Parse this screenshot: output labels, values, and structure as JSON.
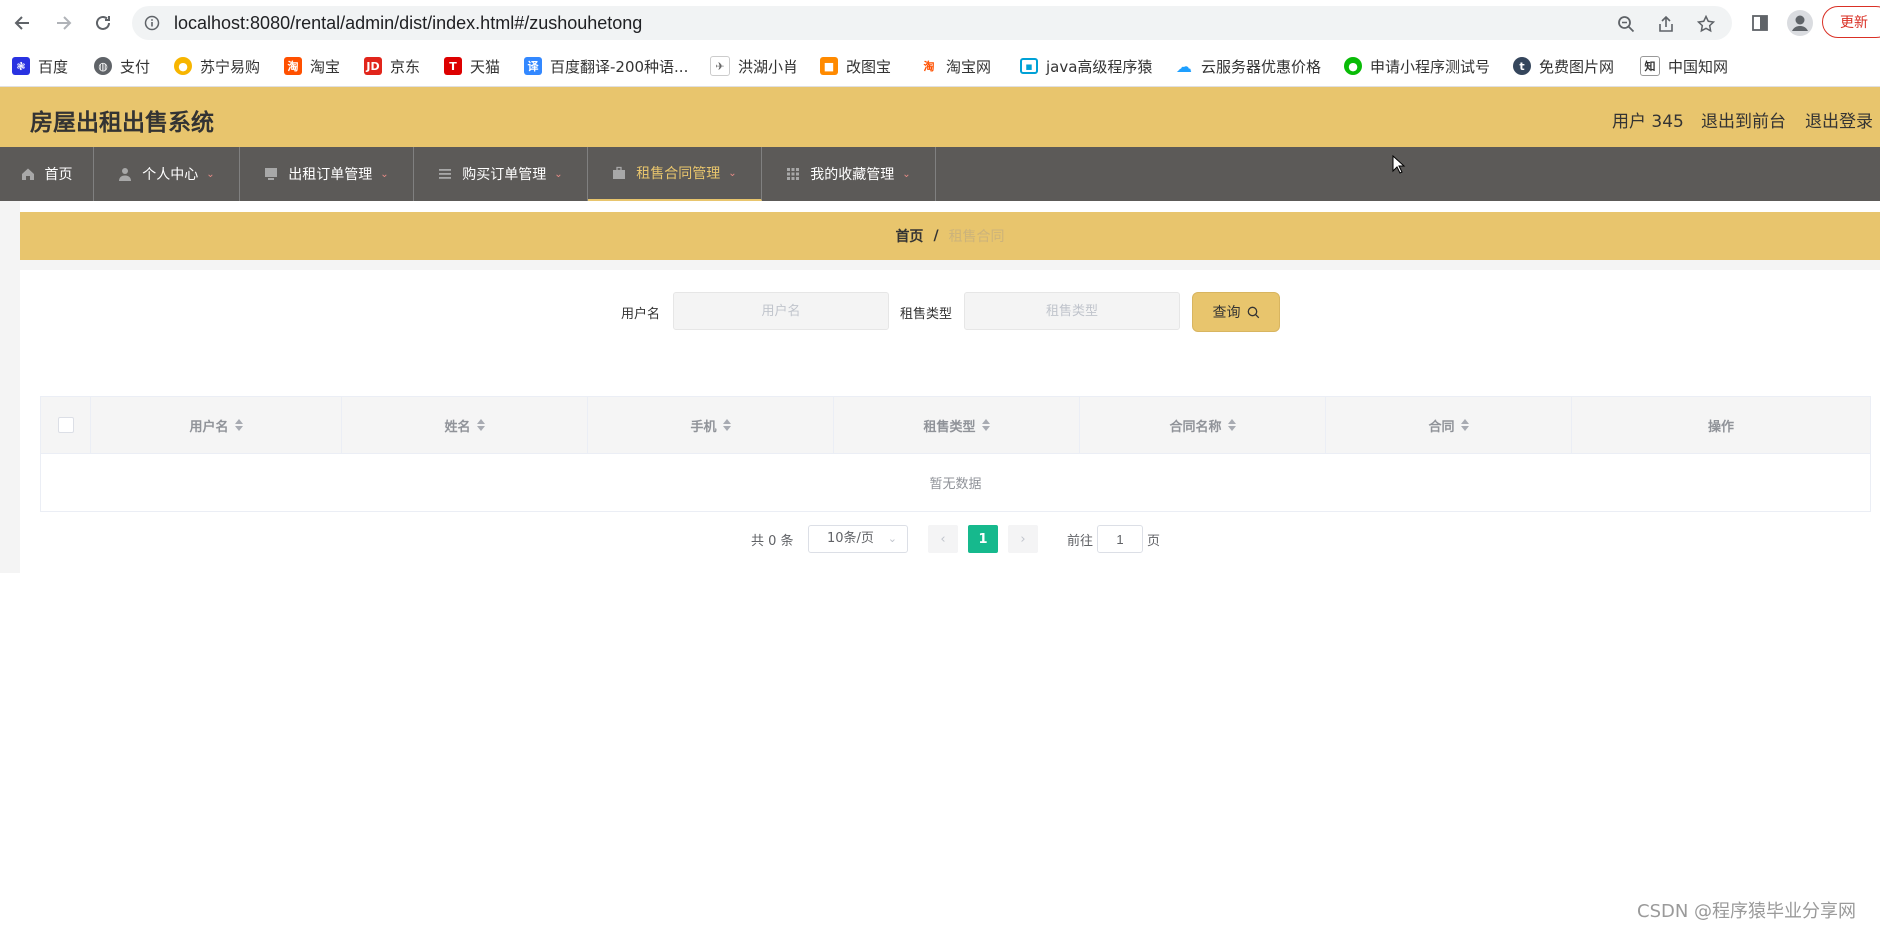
{
  "browser": {
    "url": "localhost:8080/rental/admin/dist/index.html#/zushouhetong",
    "update_label": "更新",
    "bookmarks": [
      {
        "label": "百度",
        "icon": "baidu-icon",
        "color": "#2932e1"
      },
      {
        "label": "支付",
        "icon": "globe-icon",
        "color": "#5f6368"
      },
      {
        "label": "苏宁易购",
        "icon": "suning-icon",
        "color": "#f7b500"
      },
      {
        "label": "淘宝",
        "icon": "taobao-icon",
        "color": "#ff5000"
      },
      {
        "label": "京东",
        "icon": "jd-icon",
        "color": "#e1251b"
      },
      {
        "label": "天猫",
        "icon": "tmall-icon",
        "color": "#e00"
      },
      {
        "label": "百度翻译-200种语...",
        "icon": "translate-icon",
        "color": "#3388ff"
      },
      {
        "label": "洪湖小肖",
        "icon": "bird-icon",
        "color": "#888888"
      },
      {
        "label": "改图宝",
        "icon": "gaitubao-icon",
        "color": "#ff8a00"
      },
      {
        "label": "淘宝网",
        "icon": "taobao-icon",
        "color": "#ff5000"
      },
      {
        "label": "java高级程序猿",
        "icon": "bilibili-icon",
        "color": "#00a1d6"
      },
      {
        "label": "云服务器优惠价格",
        "icon": "cloud-icon",
        "color": "#1e9fff"
      },
      {
        "label": "申请小程序测试号",
        "icon": "wechat-icon",
        "color": "#09bb07"
      },
      {
        "label": "免费图片网",
        "icon": "tumblr-icon",
        "color": "#35465c"
      },
      {
        "label": "中国知网",
        "icon": "cnki-icon",
        "color": "#333333"
      }
    ]
  },
  "app": {
    "title": "房屋出租出售系统",
    "user": "用户 345",
    "front_label": "退出到前台",
    "logout_label": "退出登录",
    "accent": "#e8c56d",
    "menu": [
      {
        "label": "首页",
        "icon": "home-icon",
        "caret": false,
        "active": false
      },
      {
        "label": "个人中心",
        "icon": "user-icon",
        "caret": true,
        "active": false
      },
      {
        "label": "出租订单管理",
        "icon": "monitor-icon",
        "caret": true,
        "active": false
      },
      {
        "label": "购买订单管理",
        "icon": "list-icon",
        "caret": true,
        "active": false
      },
      {
        "label": "租售合同管理",
        "icon": "briefcase-icon",
        "caret": true,
        "active": true
      },
      {
        "label": "我的收藏管理",
        "icon": "grid-icon",
        "caret": true,
        "active": false
      }
    ]
  },
  "breadcrumb": {
    "home": "首页",
    "separator": "/",
    "current": "租售合同"
  },
  "search": {
    "username_label": "用户名",
    "username_placeholder": "用户名",
    "username_value": "",
    "type_label": "租售类型",
    "type_placeholder": "租售类型",
    "type_value": "",
    "button_label": "查询"
  },
  "table": {
    "columns": [
      "用户名",
      "姓名",
      "手机",
      "租售类型",
      "合同名称",
      "合同",
      "操作"
    ],
    "rows": [],
    "empty_text": "暂无数据"
  },
  "pagination": {
    "total_text": "共 0 条",
    "page_size": "10条/页",
    "current_page": "1",
    "goto_label": "前往",
    "goto_value": "1",
    "page_suffix": "页"
  },
  "watermark": "CSDN @程序猿毕业分享网"
}
